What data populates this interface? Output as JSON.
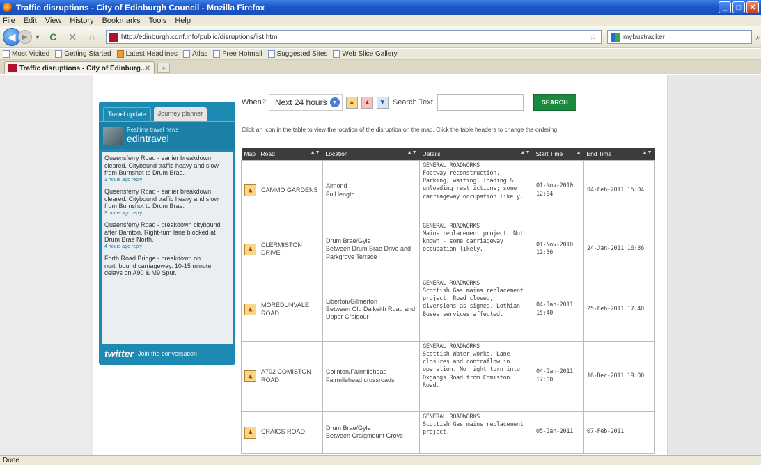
{
  "window": {
    "title": "Traffic disruptions - City of Edinburgh Council - Mozilla Firefox",
    "min": "_",
    "max": "□",
    "close": "✕"
  },
  "menu": [
    "File",
    "Edit",
    "View",
    "History",
    "Bookmarks",
    "Tools",
    "Help"
  ],
  "nav": {
    "url": "http://edinburgh.cdnf.info/public/disruptions/list.htm",
    "search_value": "mybustracker"
  },
  "bookmarks": [
    "Most Visited",
    "Getting Started",
    "Latest Headlines",
    "Atlas",
    "Free Hotmail",
    "Suggested Sites",
    "Web Slice Gallery"
  ],
  "tab": {
    "label": "Traffic disruptions - City of Edinburg..."
  },
  "widget": {
    "tabs": [
      "Travel update",
      "Journey planner"
    ],
    "header_small": "Realtime travel news",
    "header_big": "edintravel",
    "tweets": [
      {
        "text": "Queensferry Road - earlier breakdown cleared. Citybound traffic heavy and slow from Burnshot to Drum Brae.",
        "meta": "3 hours ago reply"
      },
      {
        "text": "Queensferry Road - earlier breakdown cleared. Citybound traffic heavy and slow from Burnshot to Drum Brae.",
        "meta": "3 hours ago reply"
      },
      {
        "text": "Queensferry Road - breakdown citybound after Barnton. Right-turn lane blocked at Drum Brae North.",
        "meta": "4 hours ago reply"
      },
      {
        "text": "Forth Road Bridge - breakdown on northbound carriageway. 10-15 minute delays on A90 & M9 Spur.",
        "meta": ""
      }
    ],
    "footer_logo": "twitter",
    "footer_text": "Join the conversation"
  },
  "controls": {
    "when_label": "When?",
    "when_value": "Next 24 hours",
    "search_label": "Search Text",
    "search_value": "",
    "search_button": "SEARCH"
  },
  "instructions": "Click an icon in the table to view the location of the disruption on the map. Click the table headers to change the ordering.",
  "table": {
    "headers": [
      "Map",
      "Road",
      "Location",
      "Details",
      "Start Time",
      "End Time"
    ],
    "rows": [
      {
        "road": "CAMMO GARDENS",
        "location": "Almond\nFull length",
        "details": "GENERAL ROADWORKS\nFootway reconstruction. Parking, waiting, loading & unloading restrictions; some carriageway occupation likely.",
        "start": "01-Nov-2010 12:04",
        "end": "04-Feb-2011 15:04"
      },
      {
        "road": "CLERMISTON DRIVE",
        "location": "Drum Brae/Gyle\nBetween Drum Brae Drive and Parkgrove Terrace",
        "details": "GENERAL ROADWORKS\nMains replacement project. Not known - some carriageway occupation likely.",
        "start": "01-Nov-2010 12:36",
        "end": "24-Jan-2011 16:36"
      },
      {
        "road": "MOREDUNVALE ROAD",
        "location": "Liberton/Gilmerton\nBetween Old Dalkeith Road and Upper Craigour",
        "details": "GENERAL ROADWORKS\nScottish Gas mains replacement project. Road closed, diversions as signed. Lothian Buses services affected.",
        "start": "04-Jan-2011 15:40",
        "end": "25-Feb-2011 17:40"
      },
      {
        "road": "A702 COMISTON ROAD",
        "location": "Colinton/Fairmilehead\nFairmilehead crossroads",
        "details": "GENERAL ROADWORKS\nScottish Water works. Lane closures and contraflow in operation. No right turn into Oxgangs Road from Comiston Road.",
        "start": "04-Jan-2011 17:00",
        "end": "16-Dec-2011 19:00"
      },
      {
        "road": "CRAIGS ROAD",
        "location": "Drum Brae/Gyle\nBetween Craigmount Grove",
        "details": "GENERAL ROADWORKS\nScottish Gas mains replacement project.",
        "start": "05-Jan-2011",
        "end": "07-Feb-2011"
      }
    ]
  },
  "status": "Done"
}
